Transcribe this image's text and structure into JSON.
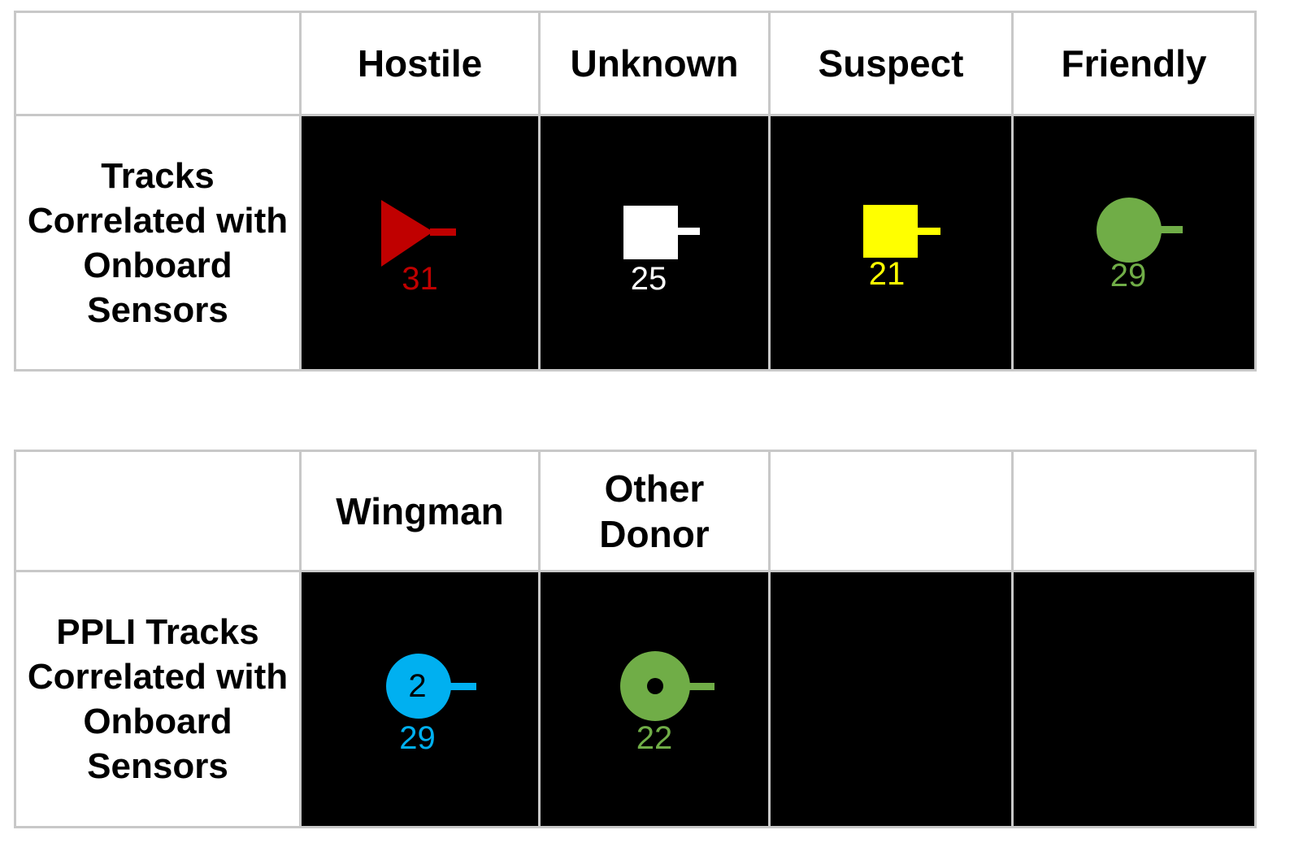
{
  "table1": {
    "corner": "",
    "columns": [
      "Hostile",
      "Unknown",
      "Suspect",
      "Friendly"
    ],
    "row_label": "Tracks Correlated with Onboard Sensors",
    "cells": [
      {
        "symbol": "triangle-icon",
        "color": "#c00000",
        "number": "31"
      },
      {
        "symbol": "square-icon",
        "color": "#ffffff",
        "number": "25"
      },
      {
        "symbol": "square-icon",
        "color": "#ffff00",
        "number": "21"
      },
      {
        "symbol": "circle-icon",
        "color": "#70ad47",
        "number": "29"
      }
    ]
  },
  "table2": {
    "corner": "",
    "columns": [
      "Wingman",
      "Other Donor",
      "",
      ""
    ],
    "row_label": "PPLI Tracks Correlated with Onboard Sensors",
    "cells": [
      {
        "symbol": "circle-with-number-icon",
        "color": "#00b0f0",
        "inner_label": "2",
        "number": "29"
      },
      {
        "symbol": "circle-with-dot-icon",
        "color": "#70ad47",
        "number": "22"
      },
      {
        "symbol": "empty",
        "color": "#000000",
        "number": ""
      },
      {
        "symbol": "empty",
        "color": "#000000",
        "number": ""
      }
    ]
  }
}
